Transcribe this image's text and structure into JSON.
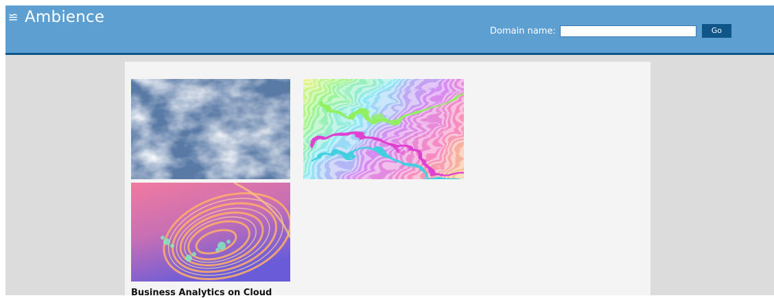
{
  "header": {
    "logo_icon": "≌",
    "title": "Ambience",
    "domain_label": "Domain name:",
    "domain_value": "",
    "go_label": "Go"
  },
  "gallery": {
    "items": [
      {
        "image": "cloud-texture-image"
      },
      {
        "image": "rainbow-swirl-image"
      },
      {
        "image": "fractal-spiral-image"
      }
    ],
    "caption": "Business Analytics on Cloud"
  },
  "colors": {
    "header": "#5d9fd1",
    "header_border": "#0e5687",
    "page_bg": "#dcdcdc",
    "content_bg": "#f4f4f4",
    "button": "#0e5687"
  }
}
